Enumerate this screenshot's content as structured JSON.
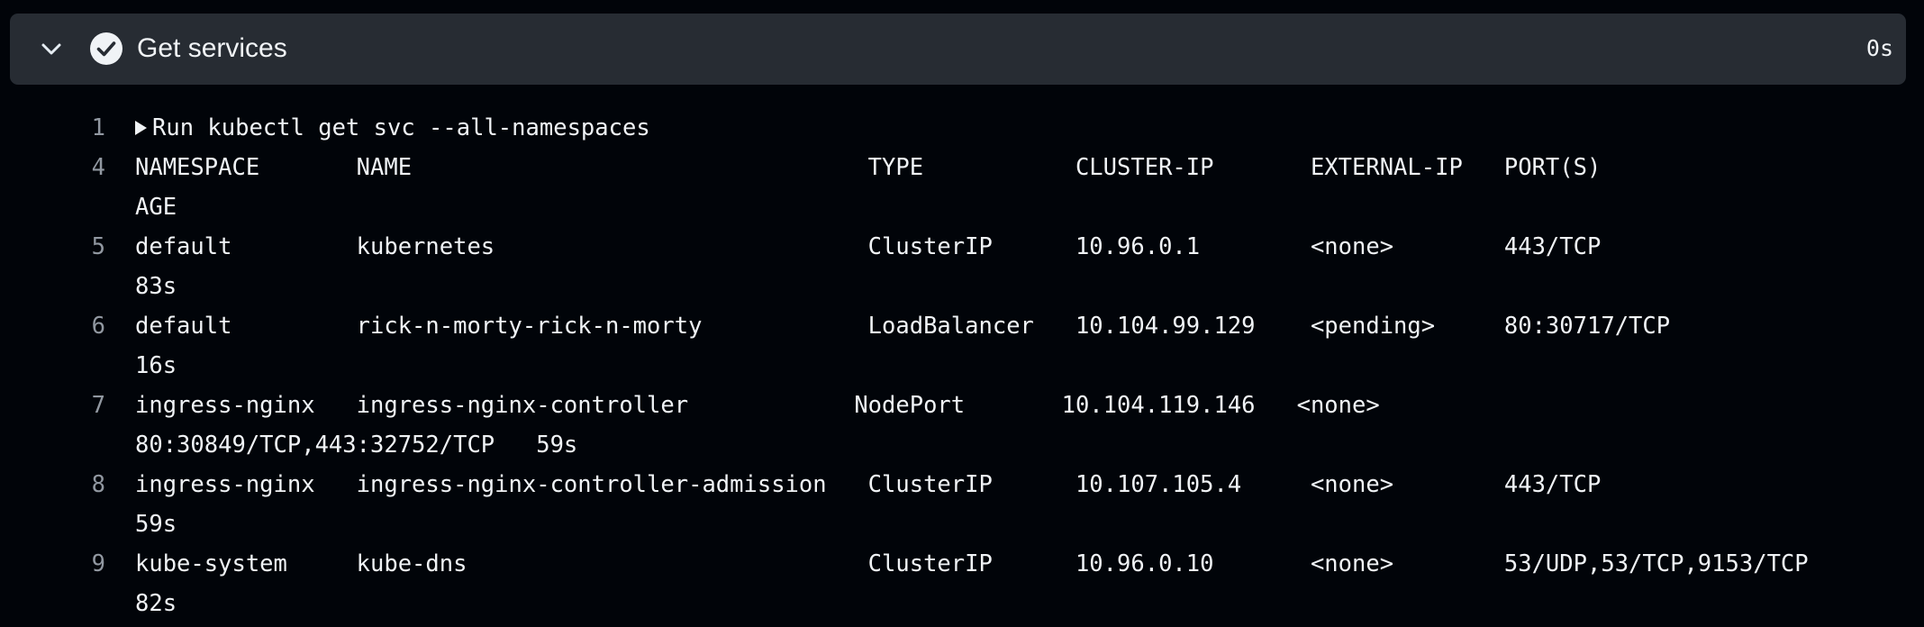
{
  "step": {
    "title": "Get services",
    "duration": "0s",
    "status": "success",
    "icons": {
      "toggle": "chevron-down-icon",
      "status": "check-circle-icon"
    }
  },
  "log": {
    "lines": [
      {
        "number": "1",
        "text": "Run kubectl get svc --all-namespaces"
      },
      {
        "number": "4",
        "text": "NAMESPACE       NAME                                 TYPE           CLUSTER-IP       EXTERNAL-IP   PORT(S)"
      },
      {
        "number": "",
        "text": "AGE"
      },
      {
        "number": "5",
        "text": "default         kubernetes                           ClusterIP      10.96.0.1        <none>        443/TCP"
      },
      {
        "number": "",
        "text": "83s"
      },
      {
        "number": "6",
        "text": "default         rick-n-morty-rick-n-morty            LoadBalancer   10.104.99.129    <pending>     80:30717/TCP"
      },
      {
        "number": "",
        "text": "16s"
      },
      {
        "number": "7",
        "text": "ingress-nginx   ingress-nginx-controller            NodePort       10.104.119.146   <none>"
      },
      {
        "number": "",
        "text": "80:30849/TCP,443:32752/TCP   59s"
      },
      {
        "number": "8",
        "text": "ingress-nginx   ingress-nginx-controller-admission   ClusterIP      10.107.105.4     <none>        443/TCP"
      },
      {
        "number": "",
        "text": "59s"
      },
      {
        "number": "9",
        "text": "kube-system     kube-dns                             ClusterIP      10.96.0.10       <none>        53/UDP,53/TCP,9153/TCP"
      },
      {
        "number": "",
        "text": "82s"
      }
    ]
  },
  "colors": {
    "background": "#010409",
    "header_background": "#272c33",
    "text": "#f0f3f6",
    "line_number": "#9198a1"
  }
}
